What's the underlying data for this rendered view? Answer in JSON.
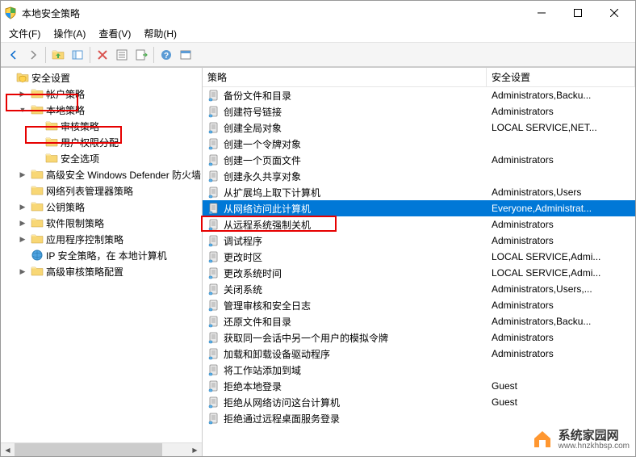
{
  "window": {
    "title": "本地安全策略"
  },
  "menu": {
    "file": "文件(F)",
    "action": "操作(A)",
    "view": "查看(V)",
    "help": "帮助(H)"
  },
  "tree": {
    "root": "安全设置",
    "items": [
      {
        "label": "帐户策略",
        "depth": 1,
        "exp": "▶"
      },
      {
        "label": "本地策略",
        "depth": 1,
        "exp": "▼",
        "hl": 1
      },
      {
        "label": "审核策略",
        "depth": 2,
        "exp": ""
      },
      {
        "label": "用户权限分配",
        "depth": 2,
        "exp": "",
        "hl": 2
      },
      {
        "label": "安全选项",
        "depth": 2,
        "exp": ""
      },
      {
        "label": "高级安全 Windows Defender 防火墙",
        "depth": 1,
        "exp": "▶"
      },
      {
        "label": "网络列表管理器策略",
        "depth": 1,
        "exp": ""
      },
      {
        "label": "公钥策略",
        "depth": 1,
        "exp": "▶"
      },
      {
        "label": "软件限制策略",
        "depth": 1,
        "exp": "▶"
      },
      {
        "label": "应用程序控制策略",
        "depth": 1,
        "exp": "▶"
      },
      {
        "label": "IP 安全策略，在 本地计算机",
        "depth": 1,
        "exp": "",
        "icon": "ip"
      },
      {
        "label": "高级审核策略配置",
        "depth": 1,
        "exp": "▶"
      }
    ]
  },
  "list": {
    "col1": "策略",
    "col2": "安全设置",
    "rows": [
      {
        "name": "备份文件和目录",
        "val": "Administrators,Backu..."
      },
      {
        "name": "创建符号链接",
        "val": "Administrators"
      },
      {
        "name": "创建全局对象",
        "val": "LOCAL SERVICE,NET..."
      },
      {
        "name": "创建一个令牌对象",
        "val": ""
      },
      {
        "name": "创建一个页面文件",
        "val": "Administrators"
      },
      {
        "name": "创建永久共享对象",
        "val": ""
      },
      {
        "name": "从扩展坞上取下计算机",
        "val": "Administrators,Users"
      },
      {
        "name": "从网络访问此计算机",
        "val": "Everyone,Administrat...",
        "selected": true
      },
      {
        "name": "从远程系统强制关机",
        "val": "Administrators"
      },
      {
        "name": "调试程序",
        "val": "Administrators"
      },
      {
        "name": "更改时区",
        "val": "LOCAL SERVICE,Admi..."
      },
      {
        "name": "更改系统时间",
        "val": "LOCAL SERVICE,Admi..."
      },
      {
        "name": "关闭系统",
        "val": "Administrators,Users,..."
      },
      {
        "name": "管理审核和安全日志",
        "val": "Administrators"
      },
      {
        "name": "还原文件和目录",
        "val": "Administrators,Backu..."
      },
      {
        "name": "获取同一会话中另一个用户的模拟令牌",
        "val": "Administrators"
      },
      {
        "name": "加载和卸载设备驱动程序",
        "val": "Administrators"
      },
      {
        "name": "将工作站添加到域",
        "val": ""
      },
      {
        "name": "拒绝本地登录",
        "val": "Guest"
      },
      {
        "name": "拒绝从网络访问这台计算机",
        "val": "Guest"
      },
      {
        "name": "拒绝通过远程桌面服务登录",
        "val": ""
      }
    ]
  },
  "watermark": {
    "name": "系统家园网",
    "url": "www.hnzkhbsp.com"
  }
}
